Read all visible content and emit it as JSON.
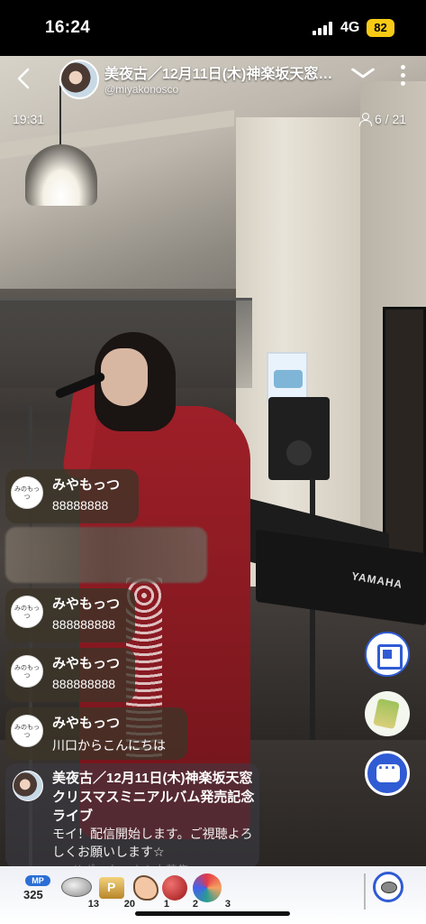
{
  "status_bar": {
    "time": "16:24",
    "network": "4G",
    "battery": "82"
  },
  "header": {
    "back_icon": "chevron-left-icon",
    "title": "美夜古／12月11日(木)神楽坂天窓…",
    "handle": "@miyakonosco",
    "expand_icon": "chevron-down-icon",
    "more_icon": "more-vertical-icon"
  },
  "stream": {
    "elapsed": "19:31",
    "viewers": "6 / 21"
  },
  "scene": {
    "keyboard_brand": "YAMAHA"
  },
  "comments": [
    {
      "name": "みやもっつ",
      "text": "88888888",
      "avatar_text": "みのもっつ"
    },
    {
      "name": "みやもっつ",
      "text": "888888888",
      "avatar_text": "みのもっつ"
    },
    {
      "name": "みやもっつ",
      "text": "888888888",
      "avatar_text": "みのもっつ"
    },
    {
      "name": "みやもっつ",
      "text": "川口からこんにちは",
      "avatar_text": "みのもっつ"
    }
  ],
  "announcement": {
    "title": "美夜古／12月11日(木)神楽坂天窓クリスマスミニアルバム発売記念ライブ",
    "body": "モイ！配信開始します。ご視聴よろしくお願いします☆",
    "faded": "✕ #サポーターさん大募集"
  },
  "bottom_bar": {
    "mp_label": "MP",
    "mp_value": "325",
    "items": [
      {
        "icon": "coin-icon",
        "count": "13"
      },
      {
        "icon": "gold-p-icon",
        "count": "20"
      },
      {
        "icon": "clap-icon",
        "count": "1"
      },
      {
        "icon": "ball-icon",
        "count": "2"
      },
      {
        "icon": "fireworks-icon",
        "count": "3"
      }
    ]
  },
  "colors": {
    "accent": "#2f5bd4",
    "battery": "#f7cb15",
    "comment_bg": "#3c3428"
  }
}
